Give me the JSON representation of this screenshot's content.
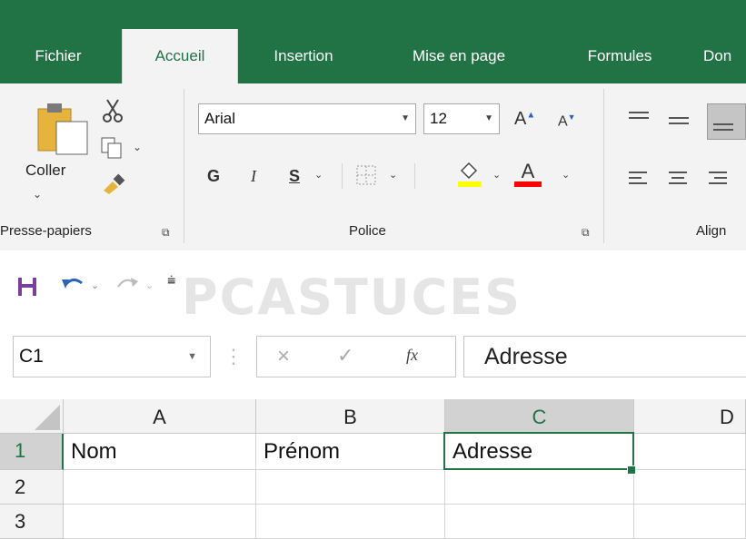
{
  "tabs": [
    {
      "label": "Fichier",
      "active": false
    },
    {
      "label": "Accueil",
      "active": true
    },
    {
      "label": "Insertion",
      "active": false
    },
    {
      "label": "Mise en page",
      "active": false
    },
    {
      "label": "Formules",
      "active": false
    },
    {
      "label": "Don",
      "active": false
    }
  ],
  "clipboard": {
    "paste_label": "Coller",
    "group_label": "Presse-papiers",
    "icons": [
      "paste-icon",
      "cut-icon",
      "copy-icon",
      "format-painter-icon"
    ]
  },
  "font": {
    "name_value": "Arial",
    "size_value": "12",
    "group_label": "Police",
    "bold_label": "G",
    "italic_label": "I",
    "underline_label": "S",
    "grow_label": "A",
    "shrink_label": "A",
    "font_color_label": "A",
    "fill_color": "#ffff00",
    "font_color": "#ff0000"
  },
  "alignment": {
    "group_label": "Align"
  },
  "qat": {
    "icons": [
      "save-icon",
      "undo-icon",
      "redo-icon",
      "customize-icon"
    ]
  },
  "watermark": "PCASTUCES",
  "formula_bar": {
    "name_box": "C1",
    "fx_label": "fx",
    "cancel_label": "×",
    "enter_label": "✓",
    "content": "Adresse"
  },
  "grid": {
    "columns": [
      "A",
      "B",
      "C",
      "D"
    ],
    "selected_column": "C",
    "rows": [
      "1",
      "2",
      "3"
    ],
    "selected_row": "1",
    "cells": {
      "A1": "Nom",
      "B1": "Prénom",
      "C1": "Adresse"
    }
  },
  "colors": {
    "accent": "#217346",
    "ribbon_bg": "#f3f3f3"
  }
}
